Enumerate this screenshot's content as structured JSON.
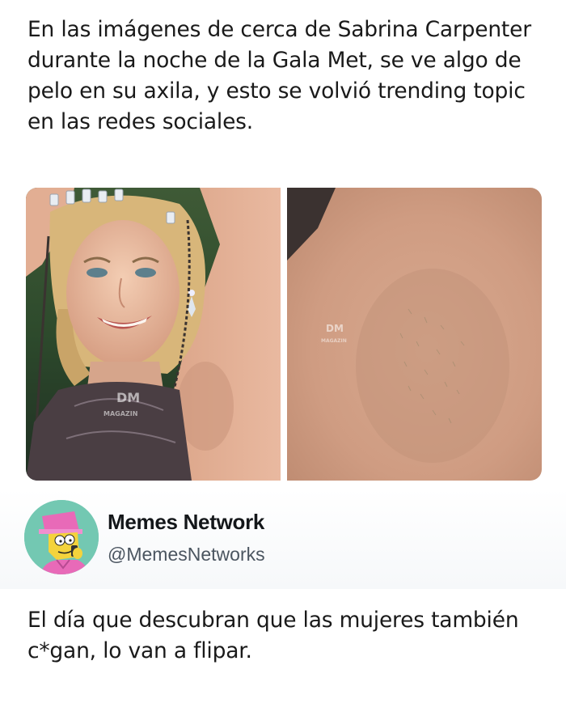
{
  "post": {
    "text": "En las imágenes de cerca de Sabrina Carpenter durante la noche de la Gala Met, se ve algo de pelo en su axila, y esto se volvió trending topic en las redes sociales."
  },
  "images": {
    "watermark_logo": "DM",
    "watermark_name": "MAGAZIN"
  },
  "tweet": {
    "display_name": "Memes Network",
    "handle": "@MemesNetworks",
    "text": "El día que descubran que las mujeres también c*gan, lo van a flipar."
  }
}
